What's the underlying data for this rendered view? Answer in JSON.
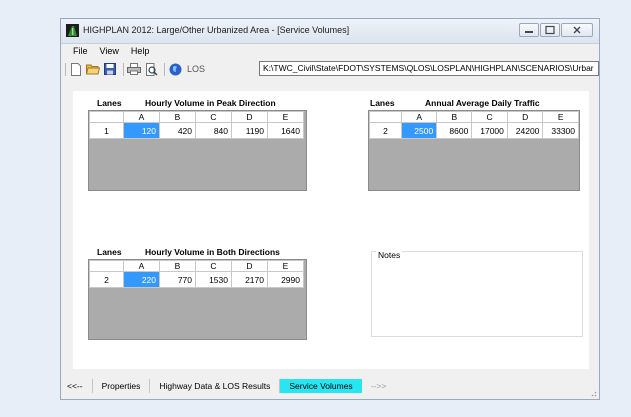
{
  "window": {
    "title": "HIGHPLAN 2012: Large/Other Urbanized Area - [Service Volumes]"
  },
  "menu": [
    "File",
    "View",
    "Help"
  ],
  "toolbar": {
    "icons": [
      "new-document-icon",
      "open-folder-icon",
      "save-icon",
      "print-icon",
      "print-preview-icon",
      "los-globe-icon"
    ],
    "los_label": "LOS",
    "path": "K:\\TWC_Civil\\State\\FDOT\\SYSTEMS\\QLOS\\LOSPLAN\\HIGHPLAN\\SCENARIOS\\Urbar"
  },
  "peak": {
    "lanes_label": "Lanes",
    "title": "Hourly Volume in Peak Direction",
    "headers": [
      "A",
      "B",
      "C",
      "D",
      "E"
    ],
    "lanes": "1",
    "values": [
      "120",
      "420",
      "840",
      "1190",
      "1640"
    ]
  },
  "aadt": {
    "lanes_label": "Lanes",
    "title": "Annual Average Daily Traffic",
    "headers": [
      "A",
      "B",
      "C",
      "D",
      "E"
    ],
    "lanes": "2",
    "values": [
      "2500",
      "8600",
      "17000",
      "24200",
      "33300"
    ]
  },
  "both": {
    "lanes_label": "Lanes",
    "title": "Hourly Volume in Both Directions",
    "headers": [
      "A",
      "B",
      "C",
      "D",
      "E"
    ],
    "lanes": "2",
    "values": [
      "220",
      "770",
      "1530",
      "2170",
      "2990"
    ]
  },
  "notes": {
    "label": "Notes"
  },
  "tabs": {
    "prev": "<<--",
    "items": [
      "Properties",
      "Highway Data & LOS Results",
      "Service Volumes"
    ],
    "next": "-->>"
  },
  "colors": {
    "selected_cell": "#3399ff",
    "active_tab": "#26e6f2",
    "grid_empty": "#ababab"
  }
}
